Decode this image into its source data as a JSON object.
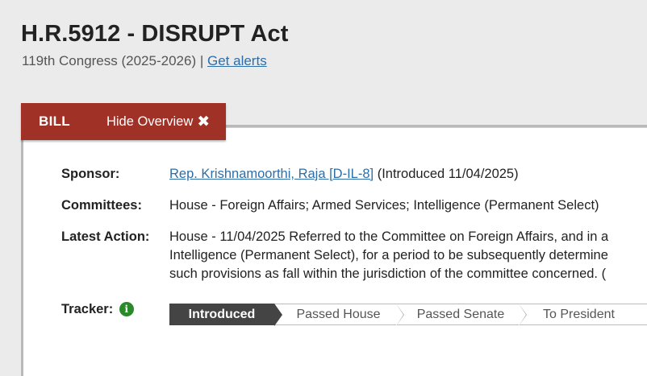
{
  "bill": {
    "title": "H.R.5912 - DISRUPT Act",
    "congress": "119th Congress (2025-2026)",
    "separator": "|",
    "alerts_link": "Get alerts"
  },
  "tabs": {
    "bill_label": "BILL",
    "hide_overview_label": "Hide Overview"
  },
  "overview": {
    "sponsor_label": "Sponsor:",
    "sponsor_link": "Rep. Krishnamoorthi, Raja [D-IL-8]",
    "sponsor_introduced": "(Introduced 11/04/2025)",
    "committees_label": "Committees:",
    "committees_value": "House - Foreign Affairs; Armed Services; Intelligence (Permanent Select)",
    "latest_action_label": "Latest Action:",
    "latest_action_line1": "House - 11/04/2025 Referred to the Committee on Foreign Affairs, and in a",
    "latest_action_line2": "Intelligence (Permanent Select), for a period to be subsequently determine",
    "latest_action_line3": "such provisions as fall within the jurisdiction of the committee concerned.  (",
    "tracker_label": "Tracker:",
    "tracker_steps": [
      "Introduced",
      "Passed House",
      "Passed Senate",
      "To President"
    ],
    "tracker_active": "Introduced"
  },
  "colors": {
    "tab_bg": "#a03127",
    "link": "#2d6ea8",
    "info_icon": "#2a8a2a",
    "active_step": "#444444"
  },
  "icons": [
    "close-icon",
    "info-icon"
  ]
}
